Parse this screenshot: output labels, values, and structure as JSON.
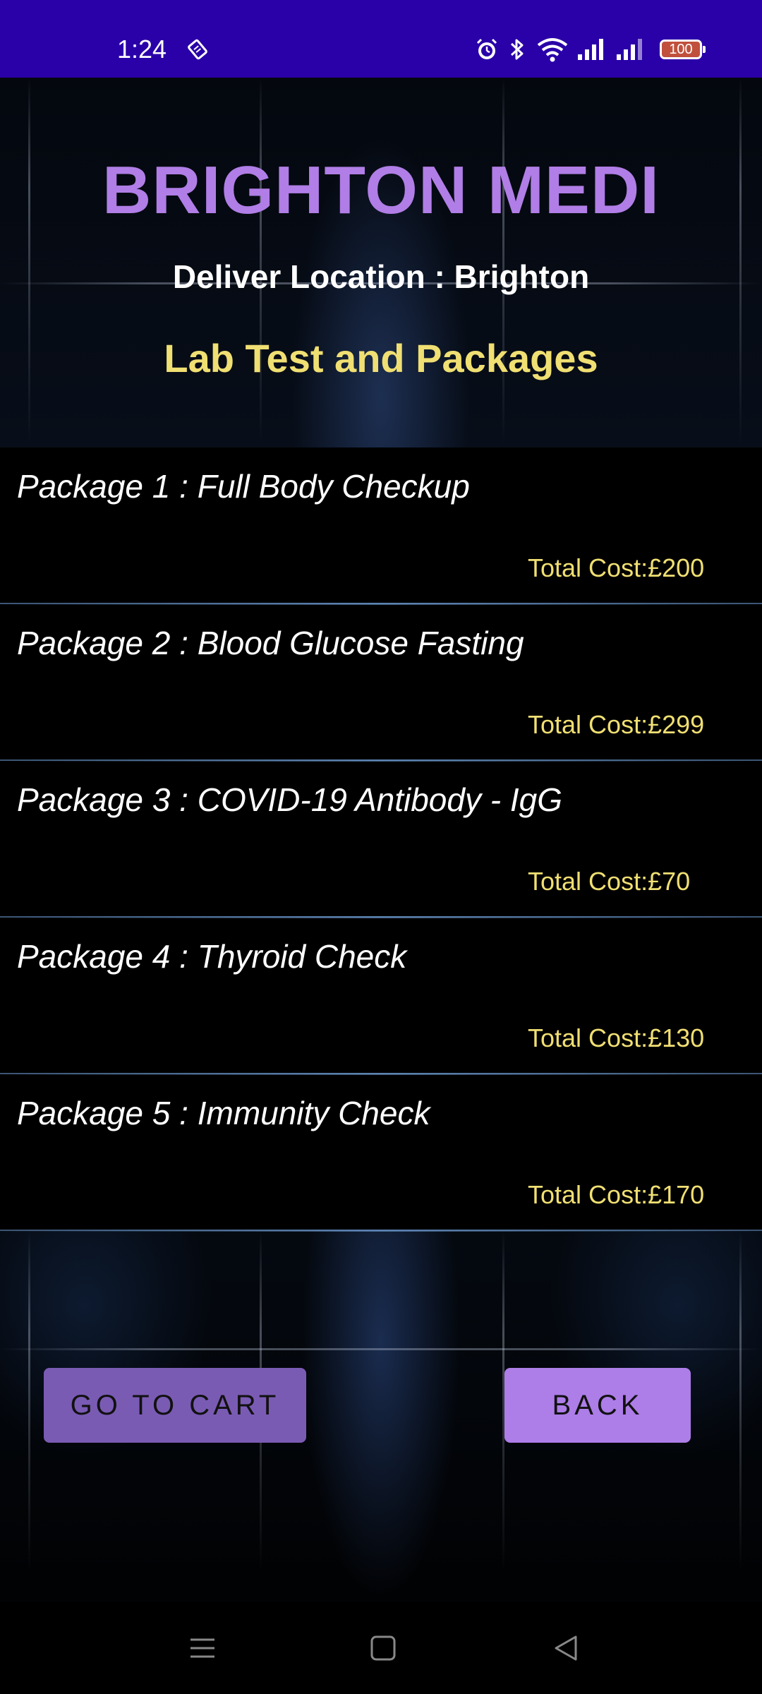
{
  "status_bar": {
    "time": "1:24",
    "battery": "100",
    "icons": [
      "sim-card-icon",
      "alarm-icon",
      "bluetooth-icon",
      "wifi-icon",
      "signal-icon",
      "signal-icon-2",
      "battery-icon"
    ]
  },
  "header": {
    "app_title": "BRIGHTON MEDI",
    "location": "Deliver Location : Brighton",
    "section_title": "Lab Test and Packages"
  },
  "packages": [
    {
      "name": "Package 1 : Full Body Checkup",
      "cost": "Total Cost:£200"
    },
    {
      "name": "Package 2 : Blood Glucose Fasting",
      "cost": "Total Cost:£299"
    },
    {
      "name": "Package 3 : COVID-19 Antibody - IgG",
      "cost": "Total Cost:£70"
    },
    {
      "name": "Package 4 : Thyroid Check",
      "cost": "Total Cost:£130"
    },
    {
      "name": "Package 5 : Immunity Check",
      "cost": "Total Cost:£170"
    }
  ],
  "actions": {
    "go_to_cart": "GO TO CART",
    "back": "BACK"
  },
  "nav": {
    "icons": [
      "menu-icon",
      "home-icon",
      "back-icon"
    ]
  },
  "colors": {
    "status_bar": "#2a00a8",
    "title": "#b07ee6",
    "accent_yellow": "#f0df72",
    "button_primary": "#7a5bb4",
    "button_secondary": "#ad7de8"
  }
}
